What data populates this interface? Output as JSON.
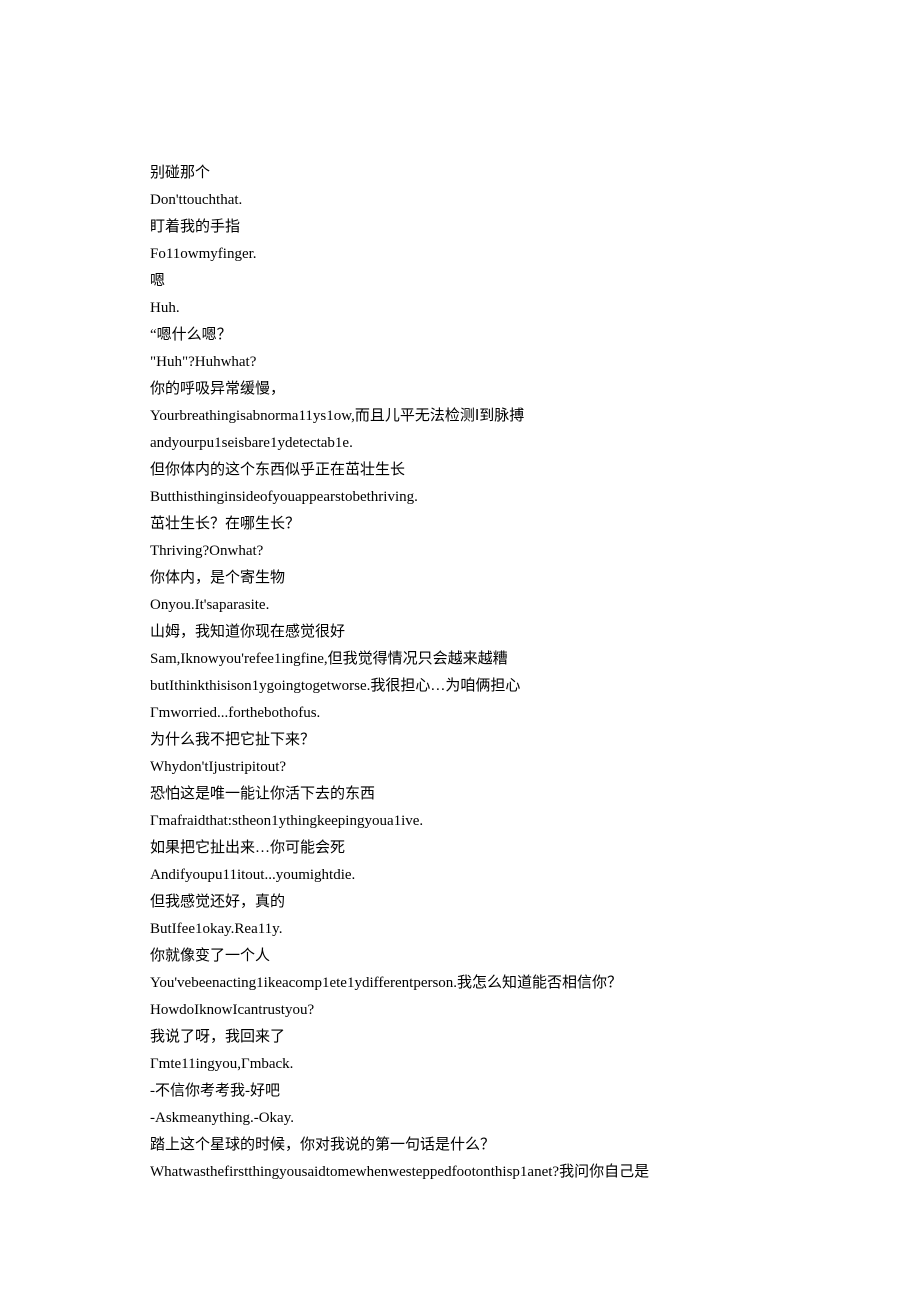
{
  "lines": [
    "别碰那个",
    "Don'ttouchthat.",
    "盯着我的手指",
    "Fo11owmyfinger.",
    "嗯",
    "Huh.",
    "“嗯什么嗯？",
    "\"Huh\"?Huhwhat?",
    "你的呼吸异常缓慢，",
    "Yourbreathingisabnorma11ys1ow,而且儿平无法检测Ⅰ到脉搏",
    "andyourpu1seisbare1ydetectab1e.",
    "但你体内的这个东西似乎正在茁壮生长",
    "Butthisthinginsideofyouappearstobethriving.",
    "茁壮生长？在哪生长？",
    "Thriving?Onwhat?",
    "你体内，是个寄生物",
    "Onyou.It'saparasite.",
    "山姆，我知道你现在感觉很好",
    "Sam,Iknowyou'refee1ingfine,但我觉得情况只会越来越糟",
    "butIthinkthisison1ygoingtogetworse.我很担心…为咱俩担心",
    "Γmworried...forthebothofus.",
    "为什么我不把它扯下来？",
    "Whydon'tIjustripitout?",
    "恐怕这是唯一能让你活下去的东西",
    "Γmafraidthat:stheon1ythingkeepingyoua1ive.",
    "如果把它扯出来…你可能会死",
    "Andifyoupu11itout...youmightdie.",
    "但我感觉还好，真的",
    "ButIfee1okay.Rea11y.",
    "你就像变了一个人",
    "You'vebeenacting1ikeacomp1ete1ydifferentperson.我怎么知道能否相信你？",
    "HowdoIknowIcantrustyou?",
    "我说了呀，我回来了",
    "Γmte11ingyou,Γmback.",
    "-不信你考考我-好吧",
    "-Askmeanything.-Okay.",
    "踏上这个星球的时候，你对我说的第一句话是什么？",
    "Whatwasthefirstthingyousaidtomewhenwesteppedfootonthisp1anet?我问你自己是"
  ]
}
